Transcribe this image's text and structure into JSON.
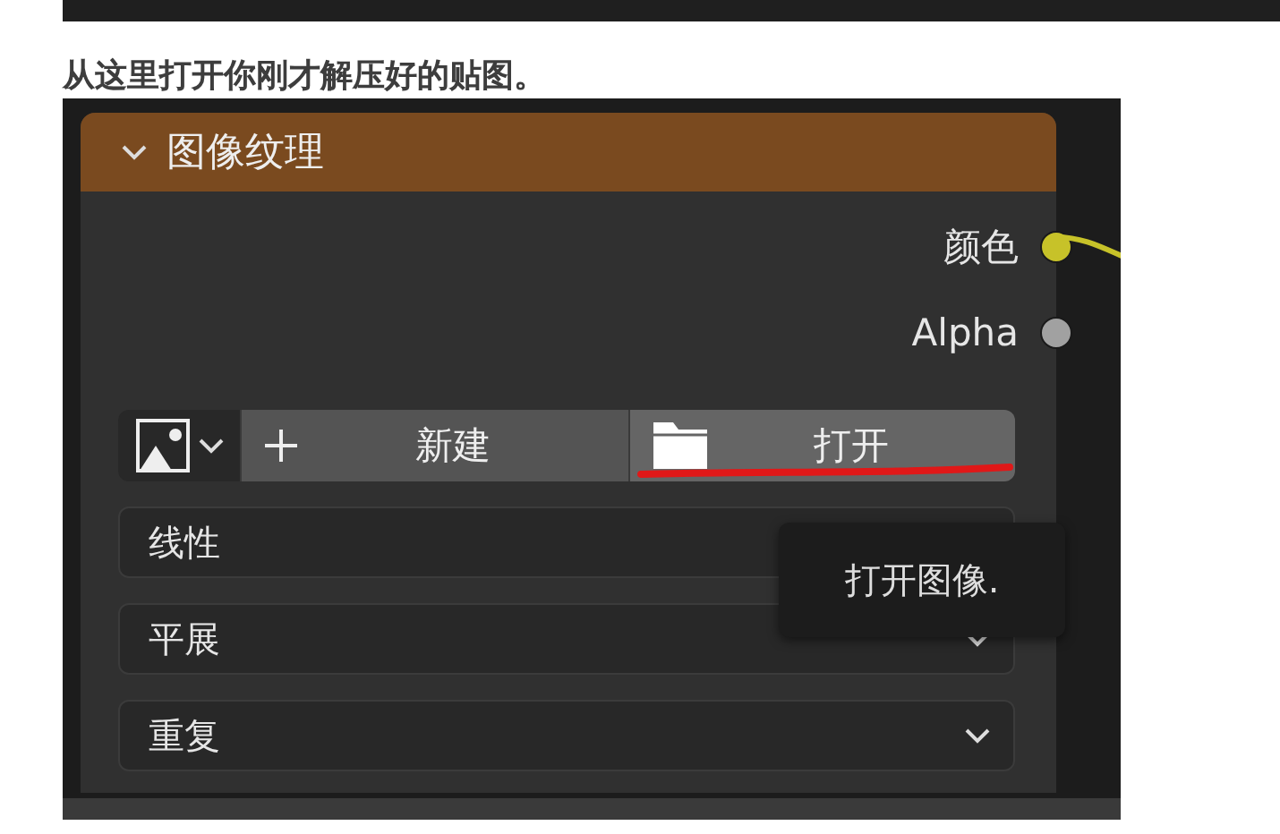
{
  "caption": "从这里打开你刚才解压好的贴图。",
  "node": {
    "title": "图像纹理",
    "expanded": true,
    "outputs": [
      {
        "label": "颜色",
        "color": "#c7c229"
      },
      {
        "label": "Alpha",
        "color": "#a1a1a1"
      }
    ],
    "buttons": [
      {
        "kind": "new",
        "label": "新建",
        "hovered": false,
        "underlined": false
      },
      {
        "kind": "open",
        "label": "打开",
        "hovered": true,
        "underlined": true
      }
    ],
    "dropdowns": [
      {
        "value": "线性"
      },
      {
        "value": "平展",
        "chevron": true
      },
      {
        "value": "重复",
        "chevron": true
      }
    ],
    "tooltip": "打开图像."
  }
}
